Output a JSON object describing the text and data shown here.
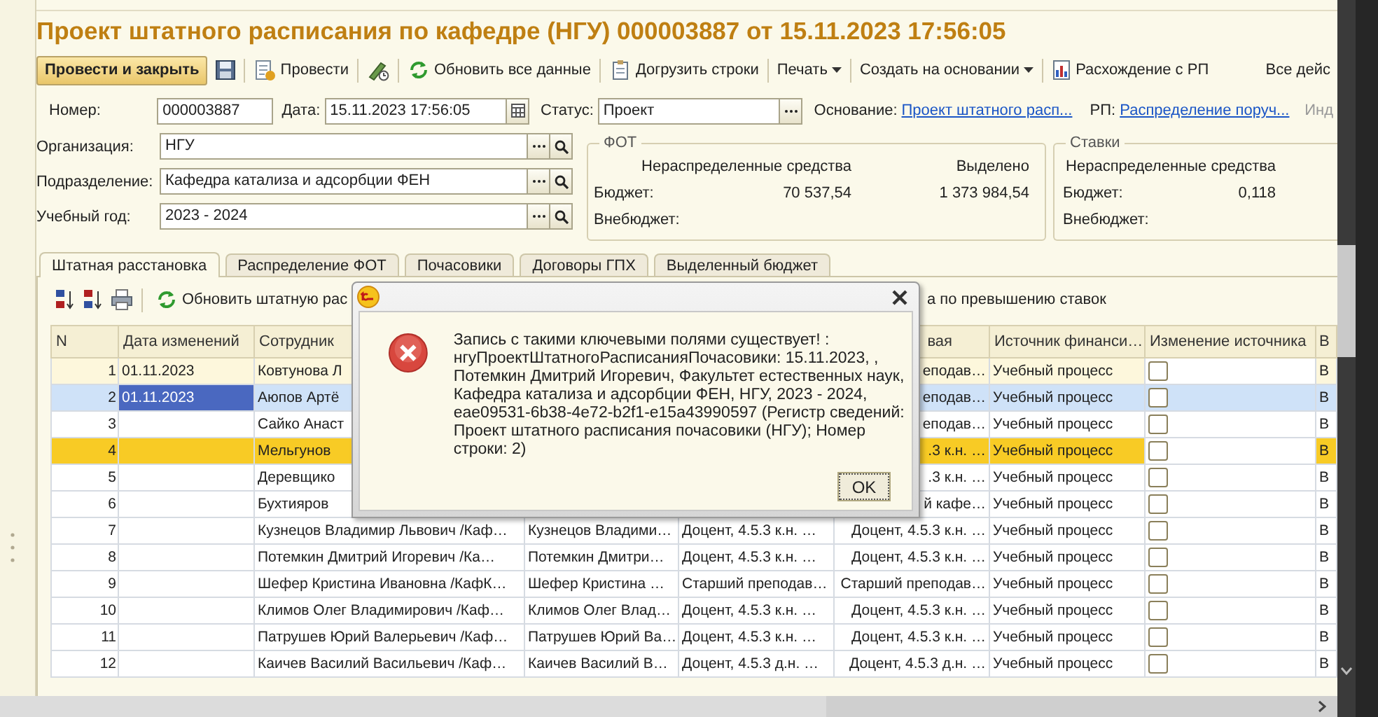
{
  "title": "Проект штатного расписания по кафедре (НГУ) 000003887 от 15.11.2023 17:56:05",
  "toolbar": {
    "primary": "Провести и закрыть",
    "post": "Провести",
    "refresh": "Обновить все данные",
    "load_rows": "Догрузить строки",
    "print": "Печать",
    "create_based_on": "Создать на основании",
    "rp_discrepancy": "Расхождение с РП",
    "all_actions": "Все дейс"
  },
  "header": {
    "number": {
      "label": "Номер:",
      "value": "000003887"
    },
    "date": {
      "label": "Дата:",
      "value": "15.11.2023 17:56:05"
    },
    "status": {
      "label": "Статус:",
      "value": "Проект"
    },
    "basis": {
      "label": "Основание:",
      "link": "Проект штатного расп..."
    },
    "rp": {
      "label": "РП:",
      "link": "Распределение поруч..."
    },
    "cut_label": "Инд"
  },
  "fields": [
    {
      "label": "Организация:",
      "value": "НГУ"
    },
    {
      "label": "Подразделение:",
      "value": "Кафедра катализа и адсорбции ФЕН"
    },
    {
      "label": "Учебный год:",
      "value": "2023 - 2024"
    }
  ],
  "fot": {
    "title": "ФОТ",
    "col_unallocated": "Нераспределенные средства",
    "col_allocated": "Выделено",
    "budget_label": "Бюджет:",
    "budget_unallocated": "70 537,54",
    "budget_allocated": "1 373 984,54",
    "offbudget_label": "Внебюджет:"
  },
  "rates": {
    "title": "Ставки",
    "col_unallocated": "Нераспределенные средства",
    "budget_label": "Бюджет:",
    "budget_unallocated": "0,118",
    "offbudget_label": "Внебюджет:"
  },
  "tabs": [
    {
      "label": "Штатная расстановка",
      "selected": true
    },
    {
      "label": "Распределение ФОТ",
      "selected": false
    },
    {
      "label": "Почасовики",
      "selected": false
    },
    {
      "label": "Договоры ГПХ",
      "selected": false
    },
    {
      "label": "Выделенный бюджет",
      "selected": false
    }
  ],
  "table_toolbar": {
    "refresh": "Обновить штатную рас",
    "tail": "а по превышению ставок"
  },
  "table": {
    "columns": {
      "n": "N",
      "date": "Дата изменений",
      "employee": "Сотрудник",
      "column_6": "вая",
      "source": "Источник финанси…",
      "source_changed": "Изменение источника",
      "column_9": "В"
    },
    "rows": [
      {
        "kind": "current",
        "selected": false,
        "n": "1",
        "date": "01.11.2023",
        "employee": "Ковтунова Л",
        "column_6": "еподав…",
        "source": "Учебный процесс",
        "source_changed": false,
        "column_9": "В"
      },
      {
        "selected": true,
        "n": "2",
        "date": "01.11.2023",
        "employee": "Аюпов Артё",
        "column_6": "еподав…",
        "source": "Учебный процесс",
        "source_changed": false,
        "column_9": "В"
      },
      {
        "selected": false,
        "n": "3",
        "employee": "Сайко Анаст",
        "column_6": "еподав…",
        "source": "Учебный процесс",
        "source_changed": false,
        "column_9": "В"
      },
      {
        "kind": "marked",
        "selected": false,
        "n": "4",
        "employee": "Мельгунов",
        "column_6": ".3 к.н. …",
        "source": "Учебный процесс",
        "source_changed": false,
        "column_9": "В"
      },
      {
        "selected": false,
        "n": "5",
        "employee": "Деревщико",
        "column_6": ".3 к.н. …",
        "source": "Учебный процесс",
        "source_changed": false,
        "column_9": "В"
      },
      {
        "selected": false,
        "n": "6",
        "employee": "Бухтияров",
        "column_6": "й кафе…",
        "source": "Учебный процесс",
        "source_changed": false,
        "column_9": "В"
      },
      {
        "selected": false,
        "n": "7",
        "employee": "Кузнецов Владимир Львович /Каф…",
        "column_4": "Кузнецов Владими…",
        "column_5": "Доцент, 4.5.3 к.н. …",
        "column_6": "Доцент, 4.5.3 к.н. …",
        "source": "Учебный процесс",
        "source_changed": false,
        "column_9": "В"
      },
      {
        "selected": false,
        "n": "8",
        "employee": "Потемкин Дмитрий Игоревич /Ка…",
        "column_4": "Потемкин Дмитри…",
        "column_5": "Доцент, 4.5.3 к.н. …",
        "column_6": "Доцент, 4.5.3 к.н. …",
        "source": "Учебный процесс",
        "source_changed": false,
        "column_9": "В"
      },
      {
        "selected": false,
        "n": "9",
        "employee": "Шефер Кристина Ивановна /КафК…",
        "column_4": "Шефер Кристина …",
        "column_5": "Старший преподав…",
        "column_6": "Старший преподав…",
        "source": "Учебный процесс",
        "source_changed": false,
        "column_9": "В"
      },
      {
        "selected": false,
        "n": "10",
        "employee": "Климов Олег Владимирович /Каф…",
        "column_4": "Климов Олег Влад…",
        "column_5": "Доцент, 4.5.3 к.н. …",
        "column_6": "Доцент, 4.5.3 к.н. …",
        "source": "Учебный процесс",
        "source_changed": false,
        "column_9": "В"
      },
      {
        "selected": false,
        "n": "11",
        "employee": "Патрушев Юрий Валерьевич /Каф…",
        "column_4": "Патрушев Юрий Ва…",
        "column_5": "Доцент, 4.5.3 к.н. …",
        "column_6": "Доцент, 4.5.3 к.н. …",
        "source": "Учебный процесс",
        "source_changed": false,
        "column_9": "В"
      },
      {
        "selected": false,
        "n": "12",
        "employee": "Каичев Василий Васильевич /Каф…",
        "column_4": "Каичев Василий В…",
        "column_5": "Доцент, 4.5.3 д.н. …",
        "column_6": "Доцент, 4.5.3 д.н. …",
        "source": "Учебный процесс",
        "source_changed": false,
        "column_9": "В"
      }
    ]
  },
  "dialog": {
    "message": "Запись с такими ключевыми полями существует! : нгуПроектШтатногоРасписанияПочасовики: 15.11.2023, , Потемкин Дмитрий Игоревич, Факультет естественных наук, Кафедра катализа и адсорбции ФЕН, НГУ, 2023 - 2024, eae09531-6b38-4e72-b2f1-e15a43990597 (Регистр сведений: Проект штатного расписания почасовики (НГУ); Номер строки: 2)",
    "ok": "OK"
  }
}
